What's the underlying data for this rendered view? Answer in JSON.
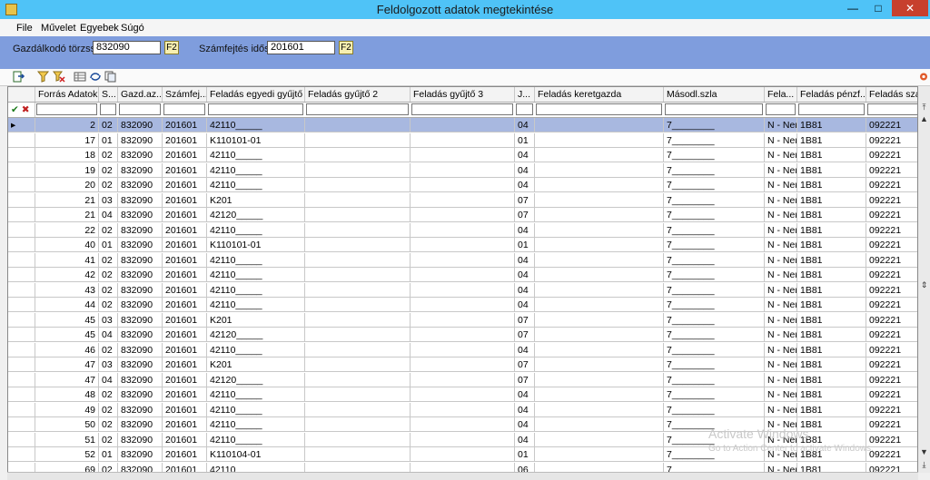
{
  "window": {
    "title": "Feldolgozott adatok megtekintése",
    "minimize_label": "—",
    "maximize_label": "□",
    "close_label": "✕"
  },
  "menu": [
    "File",
    "Művelet",
    "Egyebek",
    "Súgó"
  ],
  "filter": {
    "taxpayer_label": "Gazdálkodó törzsszám:",
    "taxpayer_value": "832090",
    "period_label": "Számfejtés időszak",
    "period_value": "201601",
    "f2_label": "F2"
  },
  "grid": {
    "columns": [
      "Forrás Adatok ID",
      "S...",
      "Gazd.az...",
      "Számfej...",
      "Feladás egyedi gyűjtő",
      "Feladás gyűjtő 2",
      "Feladás gyűjtő 3",
      "J...",
      "Feladás keretgazda",
      "Másodl.szla",
      "Fela...",
      "Feladás pénzf...",
      "Feladás szal..."
    ],
    "rows": [
      [
        "2",
        "02",
        "832090",
        "201601",
        "42110_____",
        "",
        "",
        "04",
        "",
        "7________",
        "N - Nem",
        "1B81",
        "092221"
      ],
      [
        "17",
        "01",
        "832090",
        "201601",
        "K110101-01",
        "",
        "",
        "01",
        "",
        "7________",
        "N - Nem",
        "1B81",
        "092221"
      ],
      [
        "18",
        "02",
        "832090",
        "201601",
        "42110_____",
        "",
        "",
        "04",
        "",
        "7________",
        "N - Nem",
        "1B81",
        "092221"
      ],
      [
        "19",
        "02",
        "832090",
        "201601",
        "42110_____",
        "",
        "",
        "04",
        "",
        "7________",
        "N - Nem",
        "1B81",
        "092221"
      ],
      [
        "20",
        "02",
        "832090",
        "201601",
        "42110_____",
        "",
        "",
        "04",
        "",
        "7________",
        "N - Nem",
        "1B81",
        "092221"
      ],
      [
        "21",
        "03",
        "832090",
        "201601",
        "K201",
        "",
        "",
        "07",
        "",
        "7________",
        "N - Nem",
        "1B81",
        "092221"
      ],
      [
        "21",
        "04",
        "832090",
        "201601",
        "42120_____",
        "",
        "",
        "07",
        "",
        "7________",
        "N - Nem",
        "1B81",
        "092221"
      ],
      [
        "22",
        "02",
        "832090",
        "201601",
        "42110_____",
        "",
        "",
        "04",
        "",
        "7________",
        "N - Nem",
        "1B81",
        "092221"
      ],
      [
        "40",
        "01",
        "832090",
        "201601",
        "K110101-01",
        "",
        "",
        "01",
        "",
        "7________",
        "N - Nem",
        "1B81",
        "092221"
      ],
      [
        "41",
        "02",
        "832090",
        "201601",
        "42110_____",
        "",
        "",
        "04",
        "",
        "7________",
        "N - Nem",
        "1B81",
        "092221"
      ],
      [
        "42",
        "02",
        "832090",
        "201601",
        "42110_____",
        "",
        "",
        "04",
        "",
        "7________",
        "N - Nem",
        "1B81",
        "092221"
      ],
      [
        "43",
        "02",
        "832090",
        "201601",
        "42110_____",
        "",
        "",
        "04",
        "",
        "7________",
        "N - Nem",
        "1B81",
        "092221"
      ],
      [
        "44",
        "02",
        "832090",
        "201601",
        "42110_____",
        "",
        "",
        "04",
        "",
        "7________",
        "N - Nem",
        "1B81",
        "092221"
      ],
      [
        "45",
        "03",
        "832090",
        "201601",
        "K201",
        "",
        "",
        "07",
        "",
        "7________",
        "N - Nem",
        "1B81",
        "092221"
      ],
      [
        "45",
        "04",
        "832090",
        "201601",
        "42120_____",
        "",
        "",
        "07",
        "",
        "7________",
        "N - Nem",
        "1B81",
        "092221"
      ],
      [
        "46",
        "02",
        "832090",
        "201601",
        "42110_____",
        "",
        "",
        "04",
        "",
        "7________",
        "N - Nem",
        "1B81",
        "092221"
      ],
      [
        "47",
        "03",
        "832090",
        "201601",
        "K201",
        "",
        "",
        "07",
        "",
        "7________",
        "N - Nem",
        "1B81",
        "092221"
      ],
      [
        "47",
        "04",
        "832090",
        "201601",
        "42120_____",
        "",
        "",
        "07",
        "",
        "7________",
        "N - Nem",
        "1B81",
        "092221"
      ],
      [
        "48",
        "02",
        "832090",
        "201601",
        "42110_____",
        "",
        "",
        "04",
        "",
        "7________",
        "N - Nem",
        "1B81",
        "092221"
      ],
      [
        "49",
        "02",
        "832090",
        "201601",
        "42110_____",
        "",
        "",
        "04",
        "",
        "7________",
        "N - Nem",
        "1B81",
        "092221"
      ],
      [
        "50",
        "02",
        "832090",
        "201601",
        "42110_____",
        "",
        "",
        "04",
        "",
        "7________",
        "N - Nem",
        "1B81",
        "092221"
      ],
      [
        "51",
        "02",
        "832090",
        "201601",
        "42110_____",
        "",
        "",
        "04",
        "",
        "7________",
        "N - Nem",
        "1B81",
        "092221"
      ],
      [
        "52",
        "01",
        "832090",
        "201601",
        "K110104-01",
        "",
        "",
        "01",
        "",
        "7________",
        "N - Nem",
        "1B81",
        "092221"
      ],
      [
        "69",
        "02",
        "832090",
        "201601",
        "42110_____",
        "",
        "",
        "06",
        "",
        "7________",
        "N - Nem",
        "1B81",
        "092221"
      ]
    ]
  },
  "watermark": {
    "line1": "Activate Windows",
    "line2": "Go to Action Center to activate Windows."
  },
  "colors": {
    "titlebar": "#4fc3f7",
    "filter_panel": "#7f9ddd",
    "selected_row": "#a8b8e0"
  }
}
